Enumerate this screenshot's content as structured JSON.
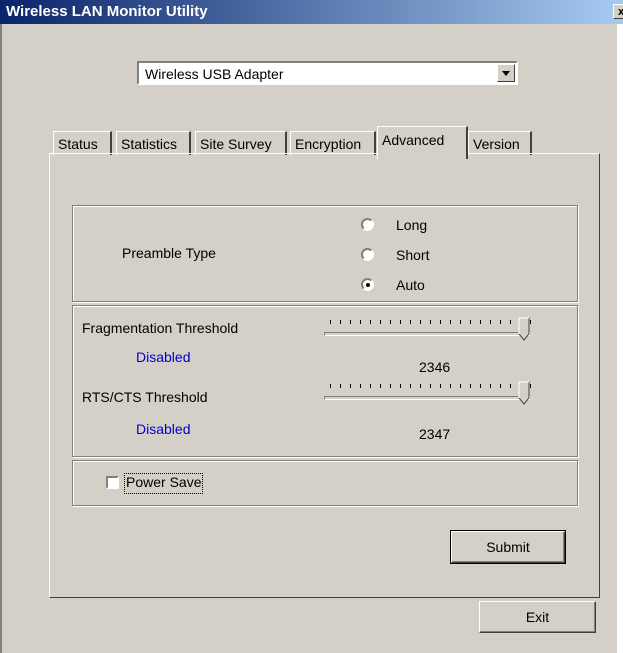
{
  "window": {
    "title": "Wireless LAN Monitor Utility",
    "close_glyph": "x"
  },
  "adapter_select": {
    "value": "Wireless USB Adapter"
  },
  "tabs": [
    {
      "label": "Status"
    },
    {
      "label": "Statistics"
    },
    {
      "label": "Site Survey"
    },
    {
      "label": "Encryption"
    },
    {
      "label": "Advanced",
      "active": true
    },
    {
      "label": "Version"
    }
  ],
  "preamble": {
    "label": "Preamble Type",
    "options": [
      {
        "label": "Long",
        "checked": false
      },
      {
        "label": "Short",
        "checked": false
      },
      {
        "label": "Auto",
        "checked": true
      }
    ]
  },
  "fragmentation": {
    "label": "Fragmentation Threshold",
    "status": "Disabled",
    "value": "2346",
    "slider_fraction": 1.0
  },
  "rts_cts": {
    "label": "RTS/CTS Threshold",
    "status": "Disabled",
    "value": "2347",
    "slider_fraction": 1.0
  },
  "power_save": {
    "label": "Power Save",
    "checked": false
  },
  "buttons": {
    "submit": "Submit",
    "exit": "Exit"
  }
}
